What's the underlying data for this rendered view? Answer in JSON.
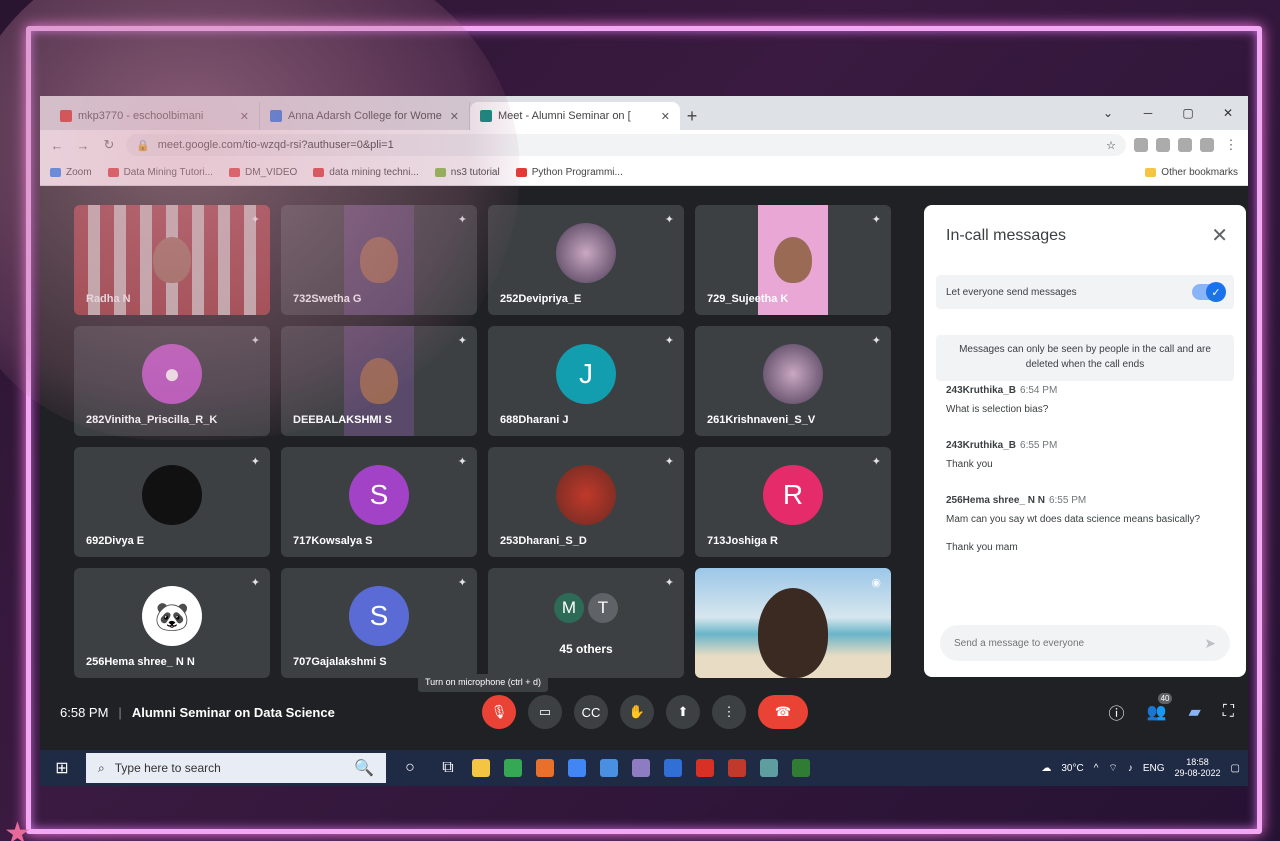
{
  "browser": {
    "tabs": [
      {
        "title": "mkp3770 - eschoolbimani",
        "color": "#d93025",
        "active": false
      },
      {
        "title": "Anna Adarsh College for Wome",
        "color": "#1a73e8",
        "active": false
      },
      {
        "title": "Meet - Alumni Seminar on [",
        "color": "#00897b",
        "active": true
      }
    ],
    "new_tab": "+",
    "url": "meet.google.com/tio-wzqd-rsi?authuser=0&pli=1",
    "bookmarks": [
      {
        "label": "Zoom",
        "color": "#2d8cff"
      },
      {
        "label": "Data Mining Tutori...",
        "color": "#e53935"
      },
      {
        "label": "DM_VIDEO",
        "color": "#e53935"
      },
      {
        "label": "data mining techni...",
        "color": "#e53935"
      },
      {
        "label": "ns3 tutorial",
        "color": "#8bc34a"
      },
      {
        "label": "Python Programmi...",
        "color": "#e53935"
      }
    ],
    "other_bookmarks": "Other bookmarks"
  },
  "participants": [
    {
      "name": "Radha N",
      "kind": "video-flag"
    },
    {
      "name": "732Swetha G",
      "kind": "video"
    },
    {
      "name": "252Devipriya_E",
      "kind": "photo"
    },
    {
      "name": "729_Sujeetha K",
      "kind": "video-pink"
    },
    {
      "name": "282Vinitha_Priscilla_R_K",
      "kind": "avatar-generic",
      "color": "#c25cc9"
    },
    {
      "name": "DEEBALAKSHMI S",
      "kind": "video"
    },
    {
      "name": "688Dharani J",
      "kind": "initial",
      "initial": "J",
      "color": "#129eaf"
    },
    {
      "name": "261Krishnaveni_S_V",
      "kind": "photo"
    },
    {
      "name": "692Divya E",
      "kind": "avatar-dark",
      "color": "#111111"
    },
    {
      "name": "717Kowsalya S",
      "kind": "initial",
      "initial": "S",
      "color": "#a142c7"
    },
    {
      "name": "253Dharani_S_D",
      "kind": "photo-red"
    },
    {
      "name": "713Joshiga R",
      "kind": "initial",
      "initial": "R",
      "color": "#e52b6a"
    },
    {
      "name": "256Hema shree_ N N",
      "kind": "avatar-panda",
      "color": "#ffffff"
    },
    {
      "name": "707Gajalakshmi S",
      "kind": "initial",
      "initial": "S",
      "color": "#5b6bd6"
    },
    {
      "name": "45 others",
      "kind": "others",
      "initials": [
        "M",
        "T"
      ]
    },
    {
      "name": "",
      "kind": "self-beach"
    }
  ],
  "chat": {
    "title": "In-call messages",
    "toggle_label": "Let everyone send messages",
    "info": "Messages can only be seen by people in the call and are deleted when the call ends",
    "messages": [
      {
        "sender": "243Kruthika_B",
        "time": "6:54 PM",
        "text": "What is selection bias?"
      },
      {
        "sender": "243Kruthika_B",
        "time": "6:55 PM",
        "text": "Thank you"
      },
      {
        "sender": "256Hema shree_ N N",
        "time": "6:55 PM",
        "text": "Mam can you say wt does data science means basically?",
        "extra": "Thank you mam"
      }
    ],
    "placeholder": "Send a message to everyone"
  },
  "tooltip": "Turn on microphone (ctrl + d)",
  "meeting": {
    "time": "6:58 PM",
    "separator": "|",
    "title": "Alumni Seminar on Data Science"
  },
  "people_count": "40",
  "taskbar": {
    "search_placeholder": "Type here to search",
    "weather": "30°C",
    "lang": "ENG",
    "time": "18:58",
    "date": "29-08-2022"
  }
}
